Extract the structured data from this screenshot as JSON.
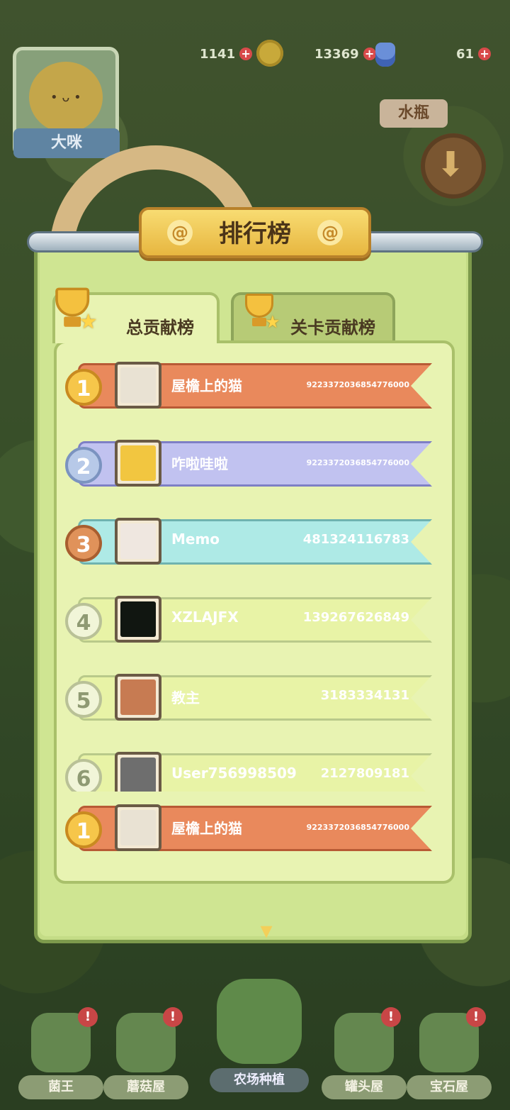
{
  "hud": {
    "stat1": "1141",
    "stat2": "13369",
    "stat3": "61",
    "plus": "+"
  },
  "player_card": {
    "name": "大咪"
  },
  "side": {
    "bottle_label": "水瓶",
    "down_glyph": "⬇"
  },
  "panel": {
    "title": "排行榜",
    "spiral": "@",
    "tabs": [
      {
        "label": "总贡献榜",
        "active": true
      },
      {
        "label": "关卡贡献榜",
        "active": false
      }
    ]
  },
  "ranking": [
    {
      "rank": "1",
      "name": "屋檐上的猫",
      "score": "9223372036854776000",
      "style": "r1",
      "avatar_color": "#e9e2d3"
    },
    {
      "rank": "2",
      "name": "咋啦哇啦",
      "score": "9223372036854776000",
      "style": "r2",
      "avatar_color": "#f2c640"
    },
    {
      "rank": "3",
      "name": "Memo",
      "score": "481324116783",
      "style": "r3",
      "avatar_color": "#efe7e0"
    },
    {
      "rank": "4",
      "name": "XZLAJFX",
      "score": "139267626849",
      "style": "plain",
      "avatar_color": "#111611"
    },
    {
      "rank": "5",
      "name": "教主",
      "score": "3183334131",
      "style": "plain",
      "avatar_color": "#c77b52"
    },
    {
      "rank": "6",
      "name": "User756998509",
      "score": "2127809181",
      "style": "plain",
      "avatar_color": "#6e6e6e"
    }
  ],
  "my_rank": {
    "rank": "1",
    "name": "屋檐上的猫",
    "score": "9223372036854776000"
  },
  "more_glyph": "▾",
  "nav": {
    "items": [
      {
        "label": "菌王",
        "badge": "!"
      },
      {
        "label": "蘑菇屋",
        "badge": "!"
      },
      {
        "label": "农场种植",
        "badge": ""
      },
      {
        "label": "罐头屋",
        "badge": "!"
      },
      {
        "label": "宝石屋",
        "badge": "!"
      }
    ]
  },
  "colors": {
    "gold": "#f6c64a",
    "silver": "#b7c9e8",
    "bronze": "#e0925a",
    "panel_green": "#c4dc86"
  }
}
